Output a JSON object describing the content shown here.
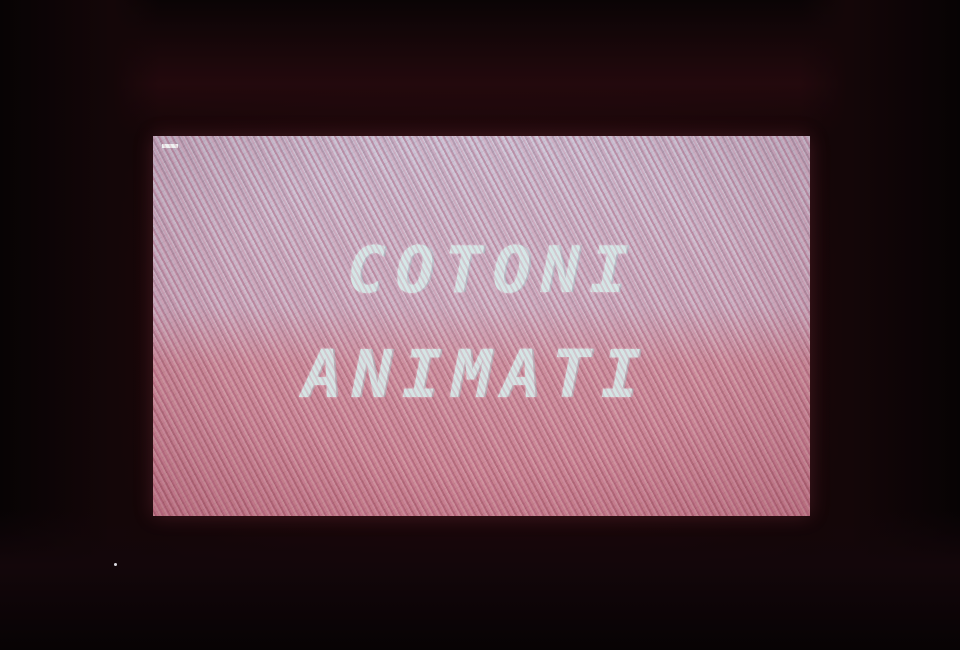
{
  "scene": {
    "title_line_1": "COTONI",
    "title_line_2": "ANIMATI"
  }
}
